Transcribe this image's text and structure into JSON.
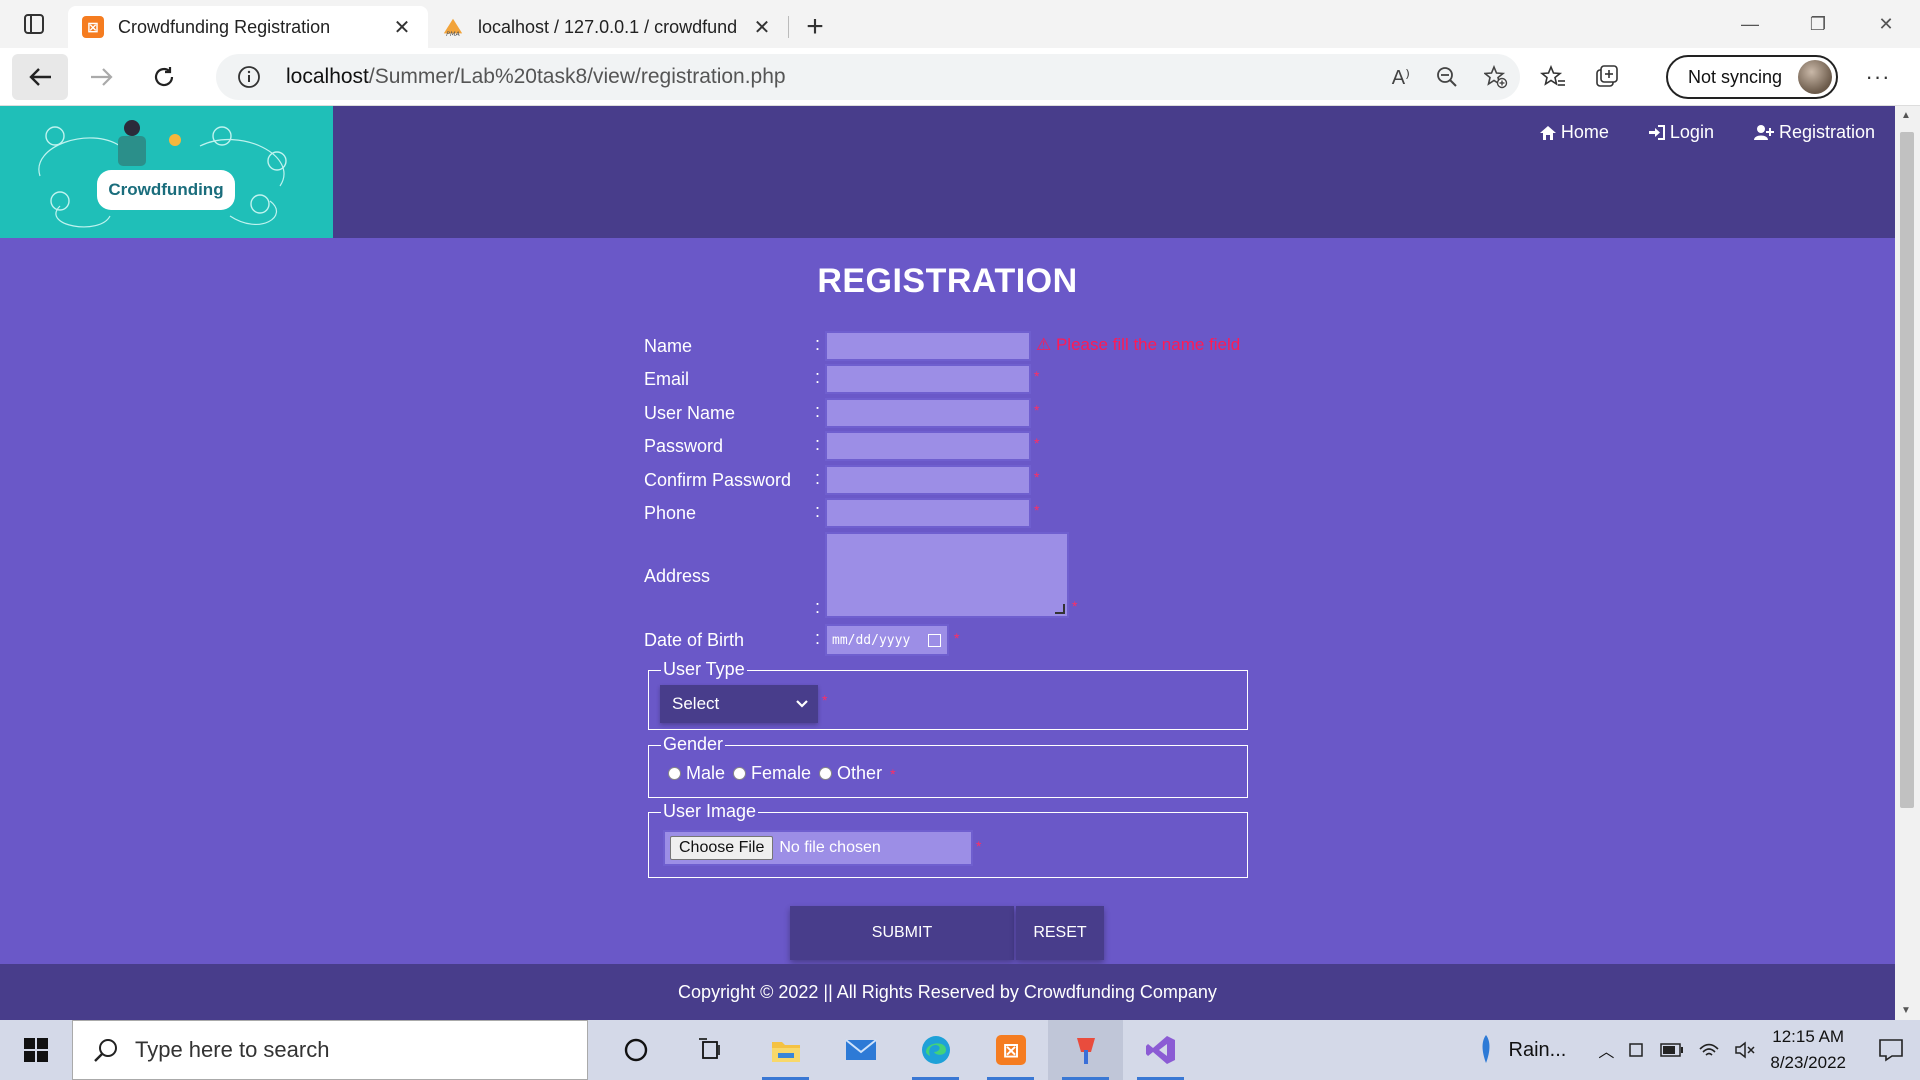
{
  "browser": {
    "tabs": [
      {
        "title": "Crowdfunding Registration",
        "active": true
      },
      {
        "title": "localhost / 127.0.0.1 / crowdfund",
        "active": false
      }
    ],
    "url_host": "localhost",
    "url_path": "/Summer/Lab%20task8/view/registration.php",
    "sync_label": "Not syncing"
  },
  "header": {
    "logo_text": "Crowdfunding",
    "nav": [
      {
        "label": "Home",
        "icon": "home-icon"
      },
      {
        "label": "Login",
        "icon": "login-icon"
      },
      {
        "label": "Registration",
        "icon": "user-plus-icon"
      }
    ]
  },
  "form": {
    "title": "REGISTRATION",
    "fields": {
      "name": "Name",
      "email": "Email",
      "username": "User Name",
      "password": "Password",
      "confirm": "Confirm Password",
      "phone": "Phone",
      "address": "Address",
      "dob": "Date of Birth"
    },
    "colon": ":",
    "required_mark": "*",
    "name_error": "⚠ Please fill the name field",
    "dob_placeholder": "mm/dd/yyyy",
    "user_type": {
      "legend": "User Type",
      "selected": "Select"
    },
    "gender": {
      "legend": "Gender",
      "options": [
        "Male",
        "Female",
        "Other"
      ]
    },
    "user_image": {
      "legend": "User Image",
      "button": "Choose File",
      "status": "No file chosen"
    },
    "submit": "SUBMIT",
    "reset": "RESET"
  },
  "footer": {
    "text": "Copyright © 2022 || All Rights Reserved by Crowdfunding Company"
  },
  "taskbar": {
    "search_placeholder": "Type here to search",
    "weather": "Rain...",
    "time": "12:15 AM",
    "date": "8/23/2022"
  },
  "colors": {
    "header": "#483d8b",
    "page": "#6a58c8",
    "logo_bg": "#1fbfb8",
    "error": "#ff1a55"
  }
}
